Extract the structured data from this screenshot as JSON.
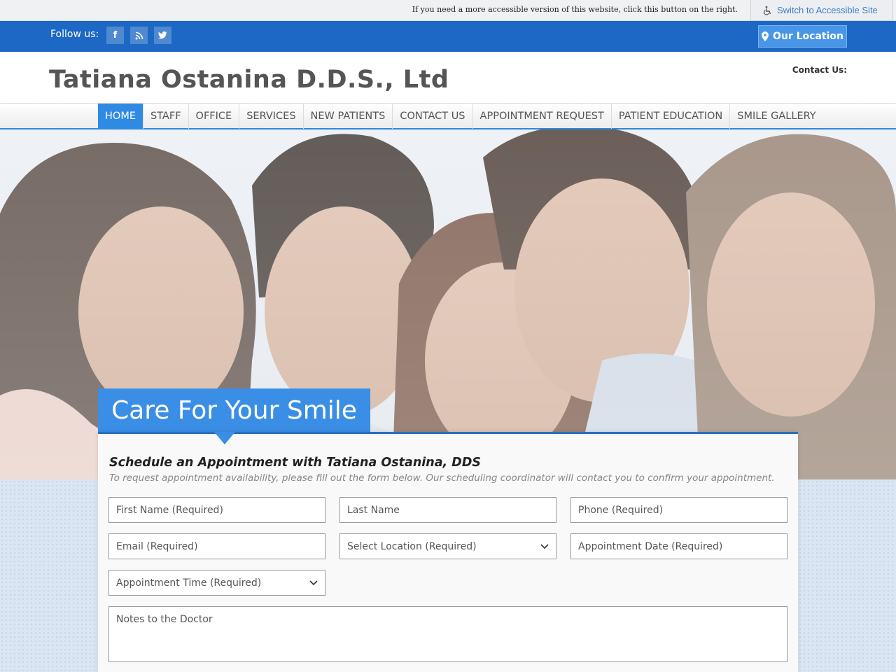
{
  "accessibility": {
    "note": "If you need a more accessible version of this website, click this button on the right.",
    "button_label": "Switch to Accessible Site"
  },
  "topbar": {
    "follow_label": "Follow us:",
    "social": [
      "facebook-icon",
      "rss-icon",
      "twitter-icon"
    ],
    "location_button": "Our Location"
  },
  "header": {
    "site_title": "Tatiana Ostanina D.D.S., Ltd",
    "contact_label": "Contact Us:"
  },
  "nav": {
    "items": [
      "HOME",
      "STAFF",
      "OFFICE",
      "SERVICES",
      "NEW PATIENTS",
      "CONTACT US",
      "APPOINTMENT REQUEST",
      "PATIENT EDUCATION",
      "SMILE GALLERY"
    ],
    "active": "HOME"
  },
  "hero": {
    "tagline": "Care For Your Smile"
  },
  "form": {
    "heading": "Schedule an Appointment with Tatiana Ostanina, DDS",
    "subtext": "To request appointment availability, please fill out the form below. Our scheduling coordinator will contact you to confirm your appointment.",
    "first_name": "First Name (Required)",
    "last_name": "Last Name",
    "phone": "Phone (Required)",
    "email": "Email (Required)",
    "location": "Select Location (Required)",
    "date": "Appointment Date (Required)",
    "time": "Appointment Time (Required)",
    "notes": "Notes to the Doctor"
  },
  "colors": {
    "brand_blue": "#1d68c4",
    "accent_blue": "#3a8ee6",
    "nav_active": "#2f8ae4"
  }
}
